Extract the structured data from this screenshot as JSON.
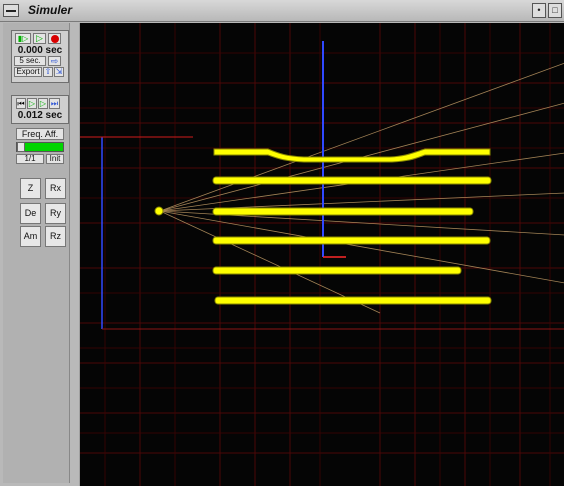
{
  "window": {
    "title": "Simuler"
  },
  "title_buttons": [
    "•",
    "□"
  ],
  "playback_panel": {
    "time_value": "0.000 sec",
    "duration_value": "5 sec.",
    "export_label": "Export"
  },
  "step_panel": {
    "time_value": "0.012 sec"
  },
  "freq_panel": {
    "label": "Freq. Aff.",
    "ratio": "1/1",
    "init_label": "Init",
    "level": 1.0
  },
  "axis_buttons": [
    "Z",
    "Rx",
    "De",
    "Ry",
    "Am",
    "Rz"
  ],
  "colors": {
    "accent_green": "#00d500",
    "record_red": "#d90000",
    "viewport_bg": "#050505",
    "grid_red": "#7a0a0a",
    "bar_yellow": "#ffff00",
    "axis_blue": "#3048ff"
  }
}
